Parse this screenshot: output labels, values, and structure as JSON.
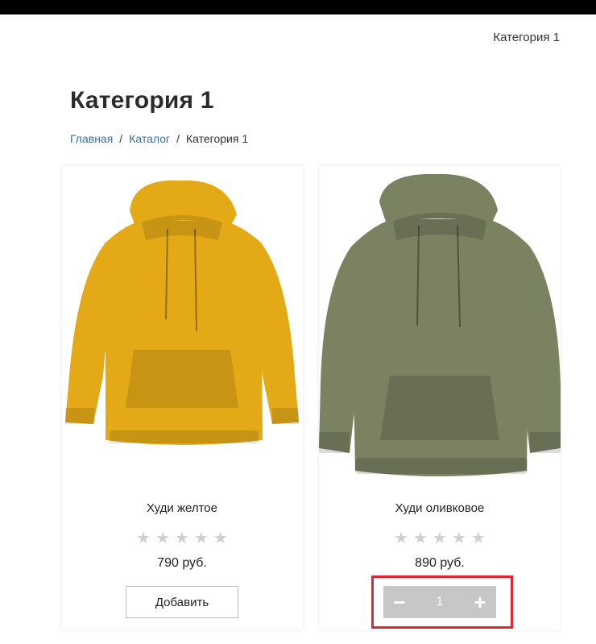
{
  "header": {
    "nav_link": "Категория 1"
  },
  "page": {
    "title": "Категория 1"
  },
  "breadcrumb": {
    "home": "Главная",
    "catalog": "Каталог",
    "current": "Категория 1",
    "separator": "/"
  },
  "products": [
    {
      "name": "Худи желтое",
      "price": "790 руб.",
      "rating": {
        "filled": 0,
        "max": 5
      },
      "button_label": "Добавить",
      "color": "#E3A916"
    },
    {
      "name": "Худи оливковое",
      "price": "890 руб.",
      "rating": {
        "filled": 0,
        "max": 5
      },
      "quantity": "1",
      "minus": "−",
      "plus": "+",
      "color": "#7B8262"
    }
  ],
  "colors": {
    "link": "#3a6ea5",
    "star_empty": "#cfcfcf",
    "stepper_bg": "#c7c7c7",
    "highlight": "#e0262f"
  },
  "star_glyph": "★"
}
